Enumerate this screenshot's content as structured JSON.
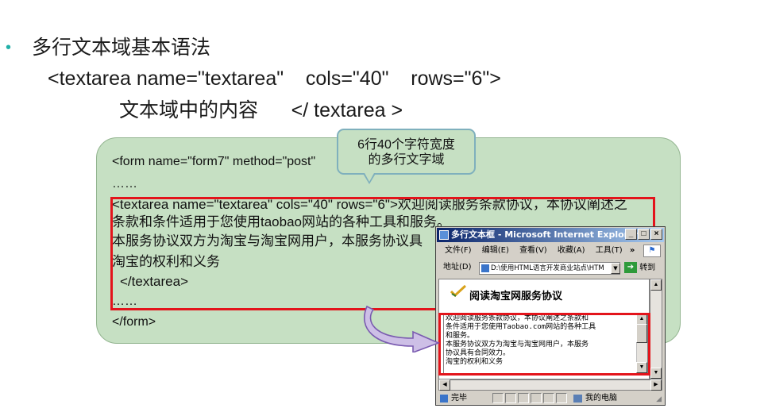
{
  "slide": {
    "bullet": "•",
    "heading": "多行文本域基本语法",
    "syntax_line1": "<textarea name=\"textarea\"    cols=\"40\"    rows=\"6\">",
    "syntax_line2": "文本域中的内容      </ textarea >"
  },
  "code": {
    "form_open": "<form name=\"form7\" method=\"post\"",
    "ellipsis1": "……",
    "ta_line1": "<textarea name=\"textarea\" cols=\"40\" rows=\"6\">欢迎阅读服务条款协议，本协议阐述之",
    "ta_line2": "条款和条件适用于您使用taobao网站的各种工具和服务。",
    "ta_line3": "本服务协议双方为淘宝与淘宝网用户，本服务协议具",
    "ta_line4": "淘宝的权利和义务",
    "ta_close": "</textarea>",
    "ellipsis2": "……",
    "form_close": "</form>"
  },
  "callout": {
    "line1": "6行40个字符宽度",
    "line2": "的多行文字域"
  },
  "browser": {
    "title": "多行文本框 - Microsoft Internet Explorer",
    "controls": [
      "_",
      "□",
      "×"
    ],
    "menu": [
      "文件(F)",
      "编辑(E)",
      "查看(V)",
      "收藏(A)",
      "工具(T)"
    ],
    "menu_more": "»",
    "address_label": "地址(D)",
    "address_value": "D:\\使用HTML语言开发商业站点\\HTM",
    "go_label": "转到",
    "page_heading": "阅读淘宝网服务协议",
    "textarea_lines": [
      "欢迎阅读服务条款协议，本协议阐述之条款和",
      "条件适用于您使用Taobao.com网站的各种工具",
      "和服务。",
      "本服务协议双方为淘宝与淘宝网用户，本服务",
      "协议具有合同效力。",
      "淘宝的权利和义务"
    ],
    "status_left": "完毕",
    "status_zone": "我的电脑"
  }
}
